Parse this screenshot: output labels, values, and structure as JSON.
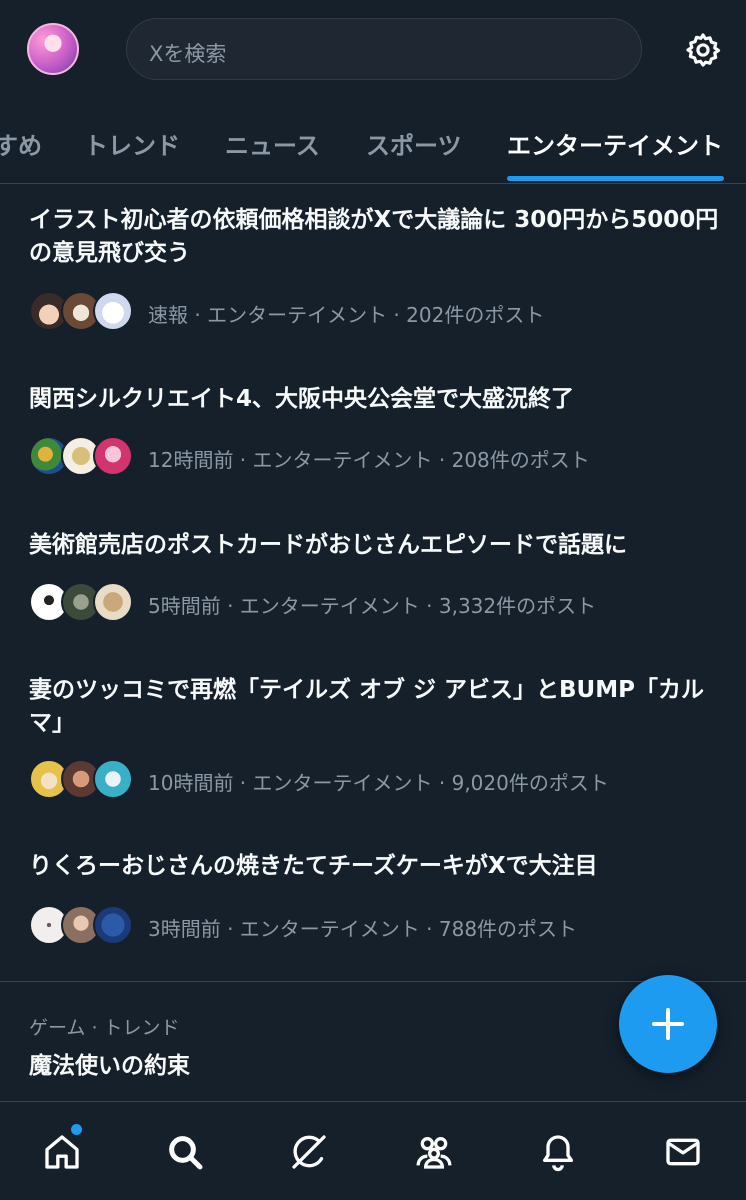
{
  "header": {
    "search_placeholder": "Xを検索"
  },
  "tabs": [
    {
      "label": "すめ"
    },
    {
      "label": "トレンド"
    },
    {
      "label": "ニュース"
    },
    {
      "label": "スポーツ"
    },
    {
      "label": "エンターテイメント",
      "active": true
    }
  ],
  "trends": [
    {
      "title": "イラスト初心者の依頼価格相談がXで大議論に 300円から5000円の意見飛び交う",
      "meta": "速報 · エンターテイメント · 202件のポスト"
    },
    {
      "title": "関西シルクリエイト4、大阪中央公会堂で大盛況終了",
      "meta": "12時間前 · エンターテイメント · 208件のポスト"
    },
    {
      "title": "美術館売店のポストカードがおじさんエピソードで話題に",
      "meta": "5時間前 · エンターテイメント · 3,332件のポスト"
    },
    {
      "title": "妻のツッコミで再燃「テイルズ オブ ジ アビス」とBUMP「カルマ」",
      "meta": "10時間前 · エンターテイメント · 9,020件のポスト"
    },
    {
      "title": "りくろーおじさんの焼きたてチーズケーキがXで大注目",
      "meta": "3時間前 · エンターテイメント · 788件のポスト"
    }
  ],
  "game_trend": {
    "category": "ゲーム · トレンド",
    "title": "魔法使いの約束"
  },
  "bottom_nav": [
    {
      "icon": "home-icon",
      "has_badge": true
    },
    {
      "icon": "search-icon"
    },
    {
      "icon": "grok-icon"
    },
    {
      "icon": "communities-icon"
    },
    {
      "icon": "bell-icon"
    },
    {
      "icon": "mail-icon"
    }
  ],
  "colors": {
    "background": "#15202b",
    "accent": "#1d9bf0",
    "secondary_text": "#8b98a5"
  }
}
